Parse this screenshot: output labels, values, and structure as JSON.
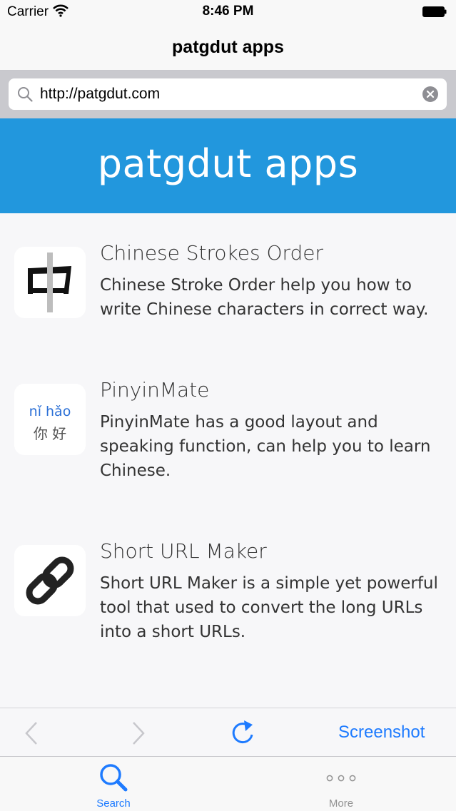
{
  "status_bar": {
    "carrier": "Carrier",
    "time": "8:46 PM",
    "icons": [
      "wifi-icon",
      "battery-icon"
    ]
  },
  "nav_bar": {
    "title": "patgdut apps"
  },
  "url_bar": {
    "value": "http://patgdut.com",
    "icons": [
      "search-icon",
      "clear-icon"
    ]
  },
  "page": {
    "site_title": "patgdut apps",
    "accent_color": "#2297dd",
    "apps": [
      {
        "name": "Chinese Strokes Order",
        "description": "Chinese Stroke Order help you how to write Chinese characters in correct way.",
        "icon_glyph": "中"
      },
      {
        "name": "PinyinMate",
        "description": "PinyinMate has a good layout and speaking function, can help you to learn Chinese.",
        "icon_pinyin": "nǐ hǎo",
        "icon_hanzi": "你 好"
      },
      {
        "name": "Short URL Maker",
        "description": "Short URL Maker is a simple yet powerful tool that used to convert the long URLs into a short URLs.",
        "icon": "link-icon"
      }
    ]
  },
  "browser_toolbar": {
    "screenshot_label": "Screenshot",
    "tint_color": "#1e7bff",
    "icons": [
      "back-icon",
      "forward-icon",
      "reload-icon"
    ]
  },
  "tab_bar": {
    "tabs": [
      {
        "label": "Search",
        "icon": "search-icon",
        "selected": true
      },
      {
        "label": "More",
        "icon": "more-icon",
        "selected": false
      }
    ]
  }
}
